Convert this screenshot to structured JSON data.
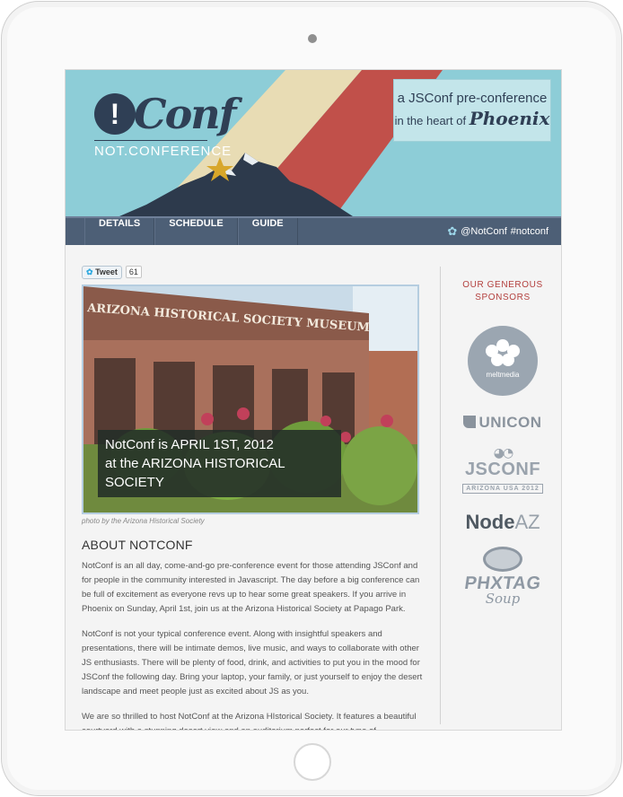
{
  "header": {
    "logo_mark": "!",
    "logo_word": "Conf",
    "logo_sub": "NOT.CONFERENCE",
    "tagline_line1": "a JSConf pre-conference",
    "tagline_line2_prefix": "in the heart of",
    "tagline_city": "Phoenix"
  },
  "nav": {
    "items": [
      "DETAILS",
      "SCHEDULE",
      "GUIDE"
    ],
    "twitter_handle": "@NotConf",
    "hashtag": "#notconf"
  },
  "tweet": {
    "label": "Tweet",
    "count": "61"
  },
  "photo": {
    "sign_text": "ARIZONA HISTORICAL SOCIETY MUSEUM",
    "banner_line1": "NotConf is APRIL 1ST, 2012",
    "banner_line2": "at the ARIZONA HISTORICAL",
    "banner_line3": "SOCIETY",
    "caption": "photo by the Arizona Historical Society"
  },
  "about": {
    "heading": "ABOUT NOTCONF",
    "p1": "NotConf is an all day, come-and-go pre-conference event for those attending JSConf and for people in the community interested in Javascript. The day before a big conference can be full of excitement as everyone revs up to hear some great speakers. If you arrive in Phoenix on Sunday, April 1st, join us at the Arizona Historical Society at Papago Park.",
    "p2": "NotConf is not your typical conference event. Along with insightful speakers and presentations, there will be intimate demos, live music, and ways to collaborate with other JS enthusiasts. There will be plenty of food, drink, and activities to put you in the mood for JSConf the following day. Bring your laptop, your family, or just yourself to enjoy the desert landscape and meet people just as excited about JS as you.",
    "p3": "We are so thrilled to host NotConf at the Arizona HIstorical Society. It features a beautiful courtyard with a stunning desert view and an auditorium perfect for our type of"
  },
  "sponsors": {
    "title_line1": "OUR GENEROUS",
    "title_line2": "SPONSORS",
    "meltmedia": "meltmedia",
    "unicon": "UNICON",
    "jsconf_word": "JSCONF",
    "jsconf_sub": "ARIZONA USA 2012",
    "nodeaz_node": "Node",
    "nodeaz_az": "AZ",
    "phx_word": "PHXTAG",
    "phx_soup": "Soup"
  },
  "colors": {
    "header_bg": "#8dcdd7",
    "stripe_cream": "#e8dcb4",
    "stripe_red": "#c1504a",
    "nav_bg": "#4d5f76",
    "sponsor_title": "#b3403e",
    "star": "#d8a72a"
  },
  "icons": {
    "twitter": "twitter-bird-icon",
    "star": "star-icon"
  }
}
